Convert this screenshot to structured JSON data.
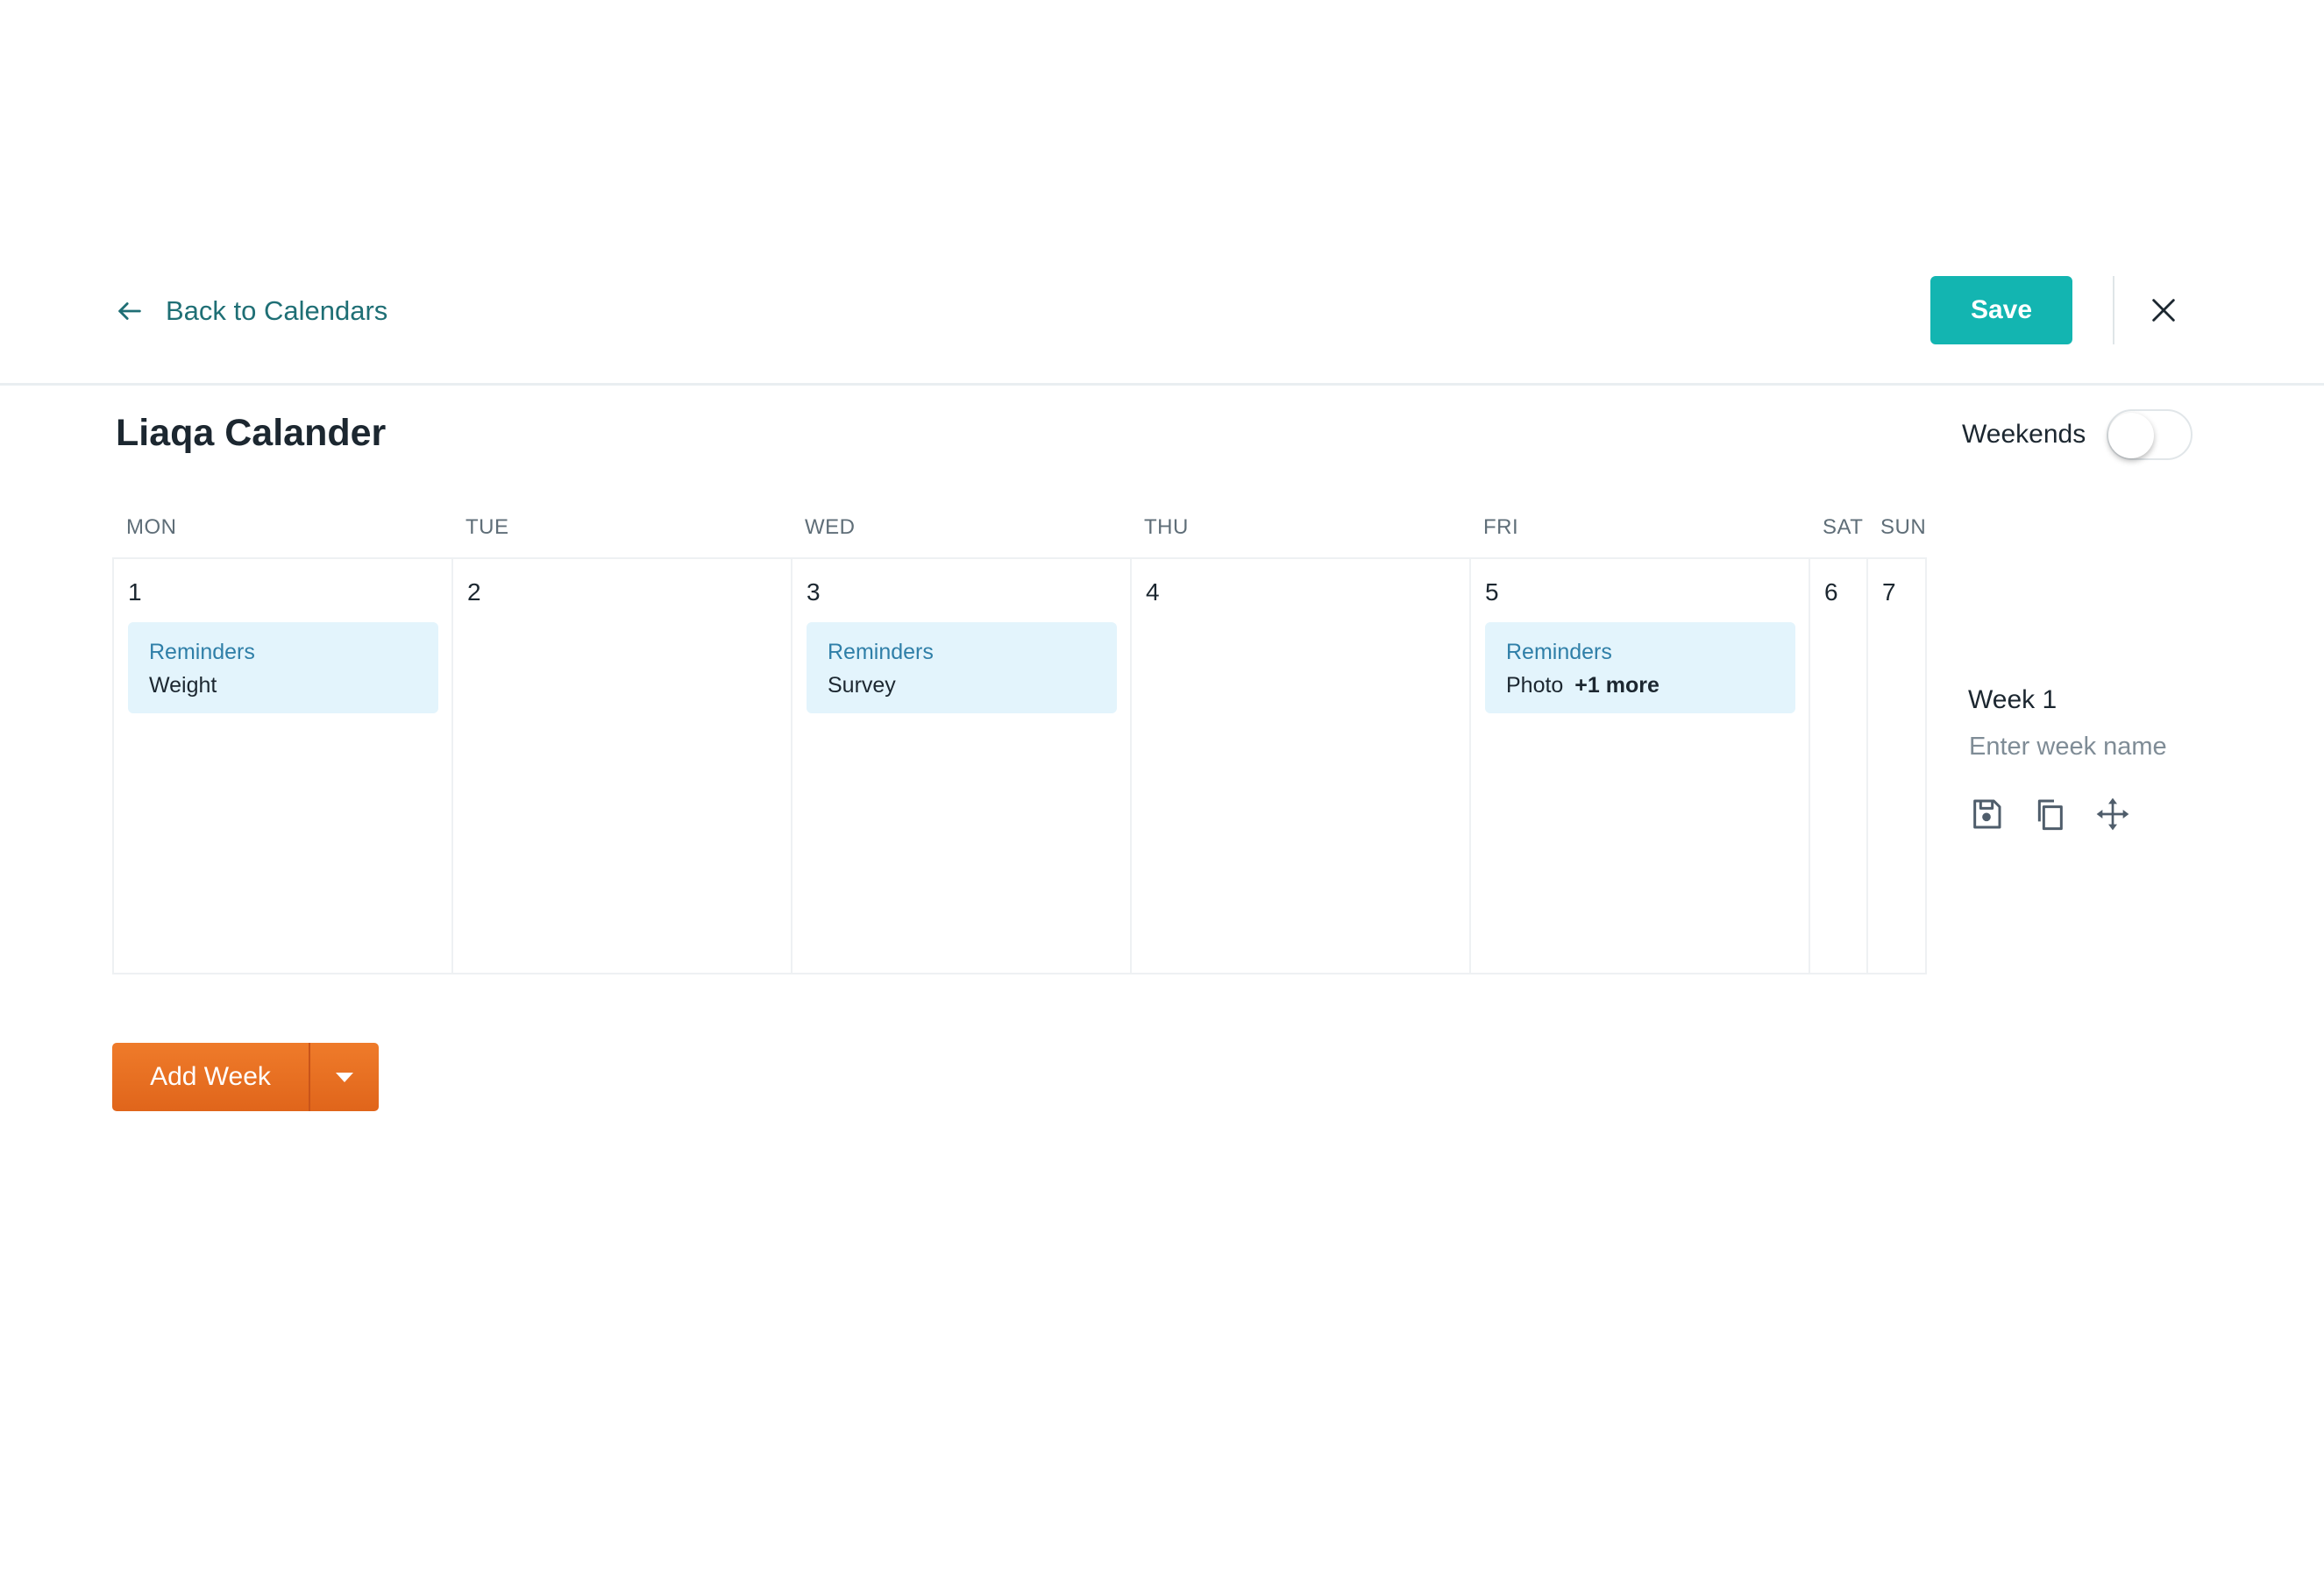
{
  "header": {
    "back_label": "Back to Calendars",
    "save_label": "Save"
  },
  "calendar": {
    "title": "Liaqa Calander",
    "weekends_label": "Weekends",
    "weekends_enabled": false,
    "days": [
      "MON",
      "TUE",
      "WED",
      "THU",
      "FRI",
      "SAT",
      "SUN"
    ],
    "cells": [
      {
        "number": "1",
        "event": {
          "title": "Reminders",
          "text": "Weight"
        }
      },
      {
        "number": "2"
      },
      {
        "number": "3",
        "event": {
          "title": "Reminders",
          "text": "Survey"
        }
      },
      {
        "number": "4"
      },
      {
        "number": "5",
        "event": {
          "title": "Reminders",
          "text": "Photo",
          "more": "+1 more"
        }
      },
      {
        "number": "6"
      },
      {
        "number": "7"
      }
    ]
  },
  "week": {
    "label": "Week 1",
    "name_placeholder": "Enter week name",
    "name_value": "",
    "icons": [
      "save-icon",
      "copy-icon",
      "move-icon"
    ]
  },
  "add_week": {
    "label": "Add Week"
  },
  "colors": {
    "primary": "#13b5b1",
    "link": "#1f6f75",
    "event_bg": "#e3f4fc",
    "event_title": "#2f7fa8",
    "add_week": "#e8701f"
  }
}
